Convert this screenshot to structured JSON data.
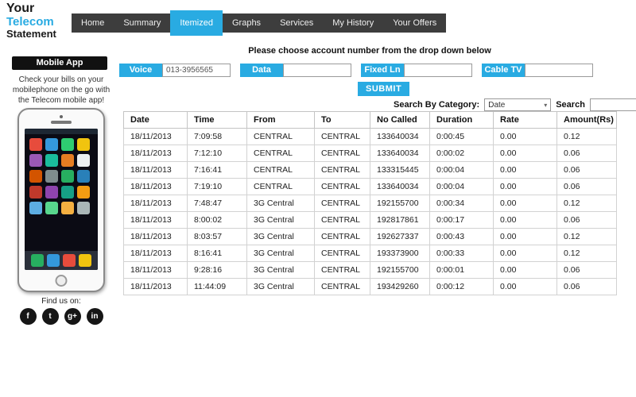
{
  "brand": {
    "line1": "Your",
    "line2": "Telecom",
    "line3": "Statement"
  },
  "nav": {
    "items": [
      {
        "label": "Home",
        "active": false
      },
      {
        "label": "Summary",
        "active": false
      },
      {
        "label": "Itemized",
        "active": true
      },
      {
        "label": "Graphs",
        "active": false
      },
      {
        "label": "Services",
        "active": false
      },
      {
        "label": "My History",
        "active": false
      },
      {
        "label": "Your Offers",
        "active": false
      }
    ]
  },
  "sidebar": {
    "header": "Mobile App",
    "promo_text": "Check your bills on your mobilephone on the go with the Telecom mobile app!",
    "find_us": "Find us on:",
    "social": [
      {
        "name": "facebook-icon",
        "glyph": "f"
      },
      {
        "name": "twitter-icon",
        "glyph": "t"
      },
      {
        "name": "google-plus-icon",
        "glyph": "g+"
      },
      {
        "name": "linkedin-icon",
        "glyph": "in"
      }
    ]
  },
  "main": {
    "instruction": "Please choose account number from the drop down below",
    "accounts": [
      {
        "label": "Voice",
        "value": "013-3956565"
      },
      {
        "label": "Data",
        "value": ""
      },
      {
        "label": "Fixed Ln",
        "value": ""
      },
      {
        "label": "Cable TV",
        "value": ""
      }
    ],
    "submit_label": "SUBMIT",
    "search_by_category_label": "Search By Category:",
    "category_value": "Date",
    "search_label": "Search",
    "search_value": ""
  },
  "table": {
    "headers": [
      "Date",
      "Time",
      "From",
      "To",
      "No Called",
      "Duration",
      "Rate",
      "Amount(Rs)"
    ],
    "rows": [
      [
        "18/11/2013",
        "7:09:58",
        "CENTRAL",
        "CENTRAL",
        "133640034",
        "0:00:45",
        "0.00",
        "0.12"
      ],
      [
        "18/11/2013",
        "7:12:10",
        "CENTRAL",
        "CENTRAL",
        "133640034",
        "0:00:02",
        "0.00",
        "0.06"
      ],
      [
        "18/11/2013",
        "7:16:41",
        "CENTRAL",
        "CENTRAL",
        "133315445",
        "0:00:04",
        "0.00",
        "0.06"
      ],
      [
        "18/11/2013",
        "7:19:10",
        "CENTRAL",
        "CENTRAL",
        "133640034",
        "0:00:04",
        "0.00",
        "0.06"
      ],
      [
        "18/11/2013",
        "7:48:47",
        "3G Central",
        "CENTRAL",
        "192155700",
        "0:00:34",
        "0.00",
        "0.12"
      ],
      [
        "18/11/2013",
        "8:00:02",
        "3G Central",
        "CENTRAL",
        "192817861",
        "0:00:17",
        "0.00",
        "0.06"
      ],
      [
        "18/11/2013",
        "8:03:57",
        "3G Central",
        "CENTRAL",
        "192627337",
        "0:00:43",
        "0.00",
        "0.12"
      ],
      [
        "18/11/2013",
        "8:16:41",
        "3G Central",
        "CENTRAL",
        "193373900",
        "0:00:33",
        "0.00",
        "0.12"
      ],
      [
        "18/11/2013",
        "9:28:16",
        "3G Central",
        "CENTRAL",
        "192155700",
        "0:00:01",
        "0.00",
        "0.06"
      ],
      [
        "18/11/2013",
        "11:44:09",
        "3G Central",
        "CENTRAL",
        "193429260",
        "0:00:12",
        "0.00",
        "0.06"
      ]
    ]
  }
}
